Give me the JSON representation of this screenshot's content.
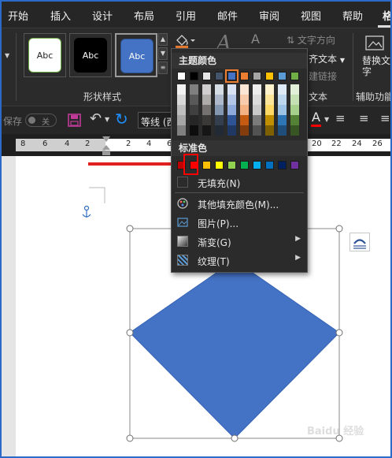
{
  "tabs": [
    "开始",
    "插入",
    "设计",
    "布局",
    "引用",
    "邮件",
    "审阅",
    "视图",
    "帮助",
    "格"
  ],
  "ribbon": {
    "shape_styles_label": "形状样式",
    "style_thumbs": [
      {
        "text": "Abc",
        "bg": "#ffffff",
        "border": "#70ad47",
        "fg": "#222222"
      },
      {
        "text": "Abc",
        "bg": "#000000",
        "border": "#000000",
        "fg": "#ffffff"
      },
      {
        "text": "Abc",
        "bg": "#4472c4",
        "border": "#2f528f",
        "fg": "#ffffff"
      }
    ],
    "text_direction": "文字方向",
    "align_text": "齐文本",
    "create_link": "建链接",
    "text_group_label": "文本",
    "alt_text": "替换文字",
    "accessibility_label": "辅助功能"
  },
  "toolbar": {
    "autosave_label": "保存",
    "autosave_state": "关",
    "font_name": "等线 (西"
  },
  "ruler": {
    "left_numbers": [
      "8",
      "6",
      "4",
      "2"
    ],
    "right_numbers": [
      "2",
      "4",
      "6",
      "20",
      "22",
      "24",
      "26"
    ]
  },
  "fill_menu": {
    "theme_colors_header": "主题颜色",
    "standard_colors_header": "标准色",
    "no_fill": "无填充(N)",
    "more_colors": "其他填充颜色(M)...",
    "picture": "图片(P)...",
    "gradient": "渐变(G)",
    "texture": "纹理(T)",
    "theme_top_row": [
      "#ffffff",
      "#000000",
      "#e7e6e6",
      "#44546a",
      "#4472c4",
      "#ed7d31",
      "#a5a5a5",
      "#ffc000",
      "#5b9bd5",
      "#70ad47"
    ],
    "theme_shades": [
      [
        "#f2f2f2",
        "#d9d9d9",
        "#bfbfbf",
        "#a6a6a6",
        "#808080"
      ],
      [
        "#7f7f7f",
        "#595959",
        "#404040",
        "#262626",
        "#0d0d0d"
      ],
      [
        "#d0cece",
        "#aeabab",
        "#757171",
        "#3b3838",
        "#171616"
      ],
      [
        "#d6dce4",
        "#adb9ca",
        "#8497b0",
        "#333f4f",
        "#222a35"
      ],
      [
        "#d9e2f3",
        "#b4c6e7",
        "#8eaadb",
        "#2f5496",
        "#1f3864"
      ],
      [
        "#fbe5d5",
        "#f7cbac",
        "#f4b183",
        "#c55a11",
        "#833c0b"
      ],
      [
        "#ededed",
        "#dbdbdb",
        "#c9c9c9",
        "#7b7b7b",
        "#525252"
      ],
      [
        "#fff2cc",
        "#ffe599",
        "#ffd965",
        "#bf8f00",
        "#7f6000"
      ],
      [
        "#deebf6",
        "#bdd7ee",
        "#9cc3e5",
        "#2e75b5",
        "#1e4e79"
      ],
      [
        "#e2efd9",
        "#c5e0b3",
        "#a8d08d",
        "#538135",
        "#375623"
      ]
    ],
    "standard_colors": [
      "#c00000",
      "#ff0000",
      "#ffc000",
      "#ffff00",
      "#92d050",
      "#00b050",
      "#00b0f0",
      "#0070c0",
      "#002060",
      "#7030a0"
    ]
  },
  "colors": {
    "shape_fill": "#4472c4",
    "highlight": "#ff0000",
    "arrow": "#e02020"
  },
  "watermark": "Baidu 经验"
}
